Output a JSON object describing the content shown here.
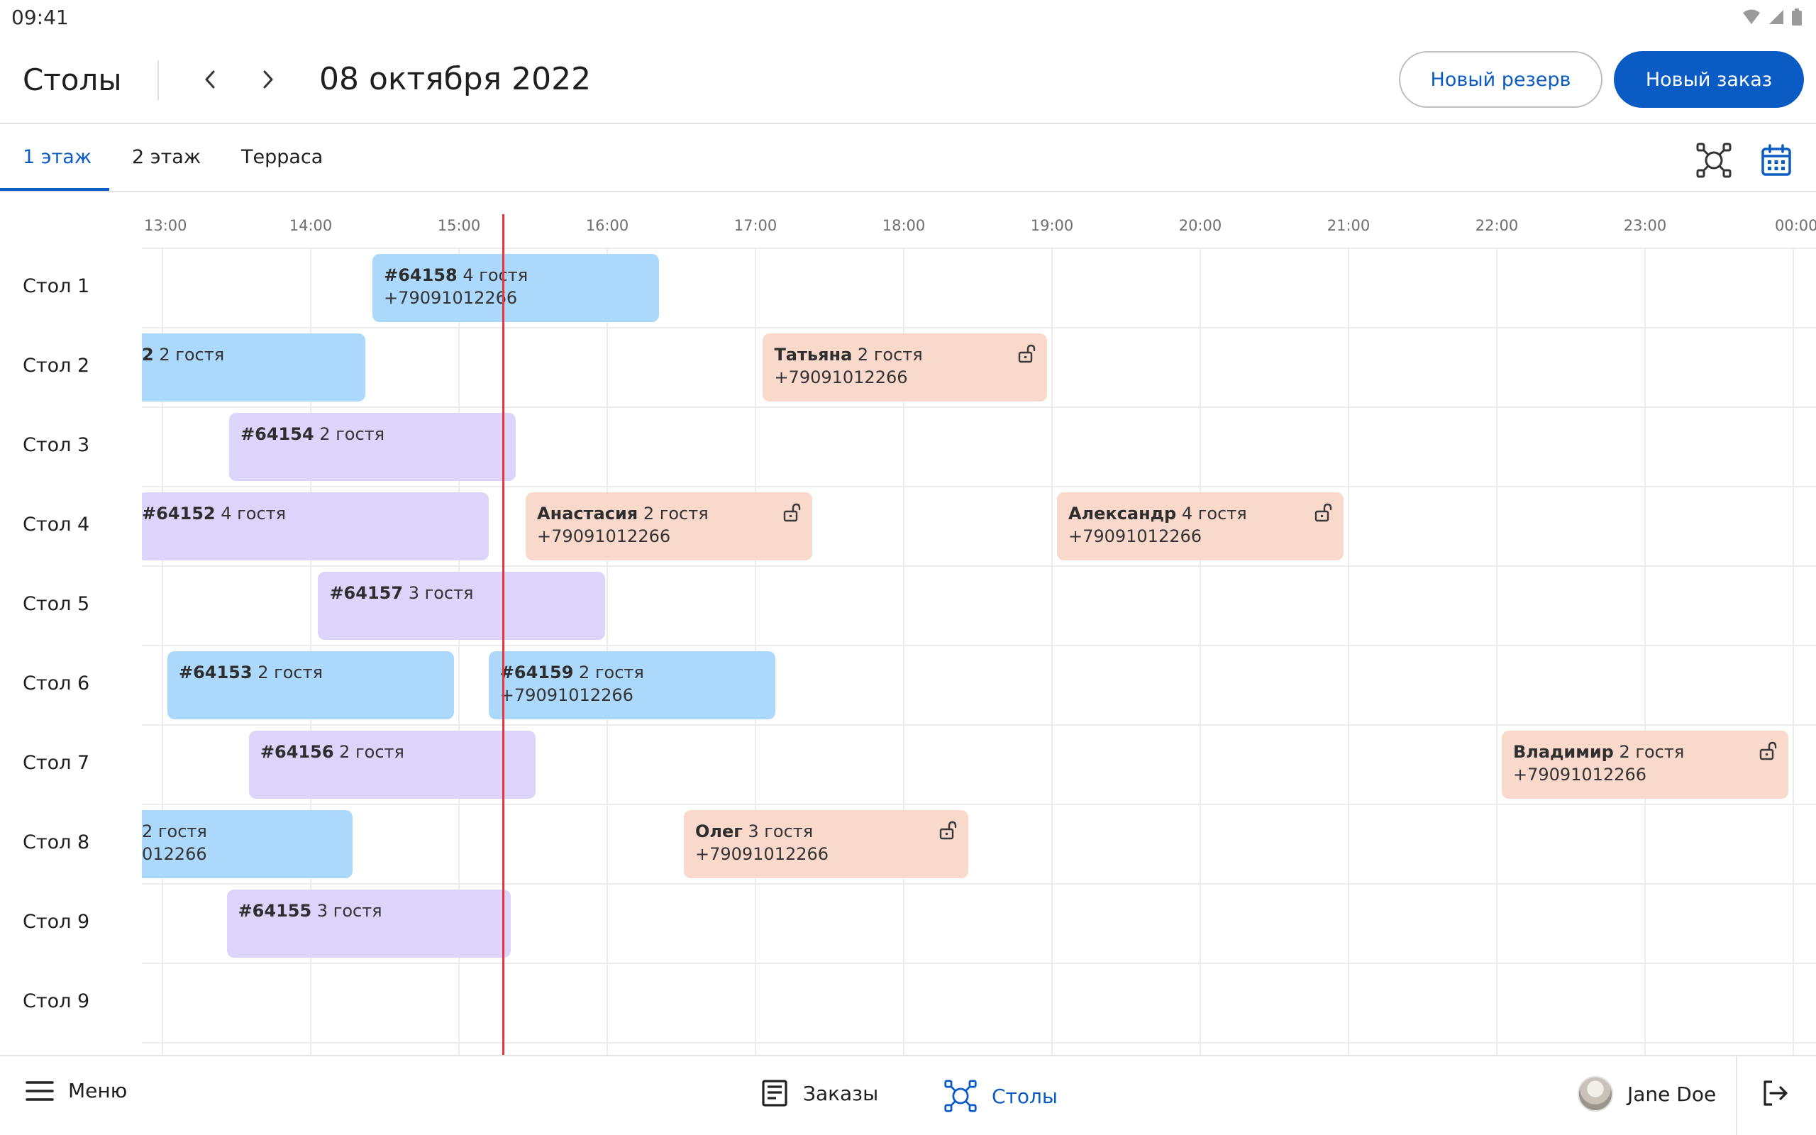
{
  "status_bar": {
    "time": "09:41"
  },
  "header": {
    "title": "Столы",
    "date": "08 октября 2022",
    "new_reserve_label": "Новый резерв",
    "new_order_label": "Новый заказ"
  },
  "tabs": [
    {
      "label": "1 этаж",
      "active": true
    },
    {
      "label": "2 этаж",
      "active": false
    },
    {
      "label": "Терраса",
      "active": false
    }
  ],
  "timeline": {
    "hours": [
      "13:00",
      "14:00",
      "15:00",
      "16:00",
      "17:00",
      "18:00",
      "19:00",
      "20:00",
      "21:00",
      "22:00",
      "23:00",
      "00:00"
    ],
    "current_time": "15:18",
    "rows": [
      "Стол 1",
      "Стол 2",
      "Стол 3",
      "Стол 4",
      "Стол 5",
      "Стол 6",
      "Стол 7",
      "Стол 8",
      "Стол 9",
      "Стол 9"
    ],
    "bookings": [
      {
        "row": 0,
        "start": "14:25",
        "end": "16:21",
        "color": "blue",
        "title": "#64158",
        "guests": "4 гостя",
        "phone": "+79091012266",
        "locked": false
      },
      {
        "row": 1,
        "start": "12:37",
        "end": "14:22",
        "color": "blue",
        "title": "2",
        "guests": "2 гостя",
        "phone": "",
        "locked": false
      },
      {
        "row": 1,
        "start": "17:03",
        "end": "18:58",
        "color": "peach",
        "title": "Татьяна",
        "guests": "2 гостя",
        "phone": "+79091012266",
        "locked": true
      },
      {
        "row": 2,
        "start": "13:27",
        "end": "15:23",
        "color": "purple",
        "title": "#64154",
        "guests": "2 гостя",
        "phone": "",
        "locked": false
      },
      {
        "row": 3,
        "start": "12:50",
        "end": "15:12",
        "color": "purple",
        "title": "#64152",
        "guests": "4 гостя",
        "phone": "",
        "locked": false
      },
      {
        "row": 3,
        "start": "15:27",
        "end": "17:23",
        "color": "peach",
        "title": "Анастасия",
        "guests": "2 гостя",
        "phone": "+79091012266",
        "locked": true
      },
      {
        "row": 3,
        "start": "19:02",
        "end": "20:58",
        "color": "peach",
        "title": "Александр",
        "guests": "4 гостя",
        "phone": "+79091012266",
        "locked": true
      },
      {
        "row": 4,
        "start": "14:03",
        "end": "15:59",
        "color": "purple",
        "title": "#64157",
        "guests": "3 гостя",
        "phone": "",
        "locked": false
      },
      {
        "row": 5,
        "start": "13:02",
        "end": "14:58",
        "color": "blue",
        "title": "#64153",
        "guests": "2 гостя",
        "phone": "",
        "locked": false
      },
      {
        "row": 5,
        "start": "15:12",
        "end": "17:08",
        "color": "blue",
        "title": "#64159",
        "guests": "2 гостя",
        "phone": "+79091012266",
        "locked": false
      },
      {
        "row": 6,
        "start": "13:35",
        "end": "15:31",
        "color": "purple",
        "title": "#64156",
        "guests": "2 гостя",
        "phone": "",
        "locked": false
      },
      {
        "row": 6,
        "start": "22:02",
        "end": "23:58",
        "color": "peach",
        "title": "Владимир",
        "guests": "2 гостя",
        "phone": "+79091012266",
        "locked": true
      },
      {
        "row": 7,
        "start": "12:37",
        "end": "14:17",
        "color": "blue",
        "title": "",
        "guests": "2 гостя",
        "phone": "012266",
        "locked": false
      },
      {
        "row": 7,
        "start": "16:31",
        "end": "18:26",
        "color": "peach",
        "title": "Олег",
        "guests": "3 гостя",
        "phone": "+79091012266",
        "locked": true
      },
      {
        "row": 8,
        "start": "13:26",
        "end": "15:21",
        "color": "purple",
        "title": "#64155",
        "guests": "3 гостя",
        "phone": "",
        "locked": false
      }
    ]
  },
  "bottom_nav": {
    "menu_label": "Меню",
    "orders_label": "Заказы",
    "tables_label": "Столы",
    "user_name": "Jane Doe"
  },
  "colors": {
    "accent": "#0a5bc4",
    "now_line": "#e8353a",
    "blue": "#acd8fb",
    "purple": "#dcd4fb",
    "peach": "#f8d9cb"
  },
  "icons": [
    "chevron-left-icon",
    "chevron-right-icon",
    "tables-layout-icon",
    "calendar-icon",
    "lock-open-icon",
    "menu-icon",
    "orders-icon",
    "logout-icon",
    "wifi-icon",
    "signal-icon",
    "battery-icon"
  ]
}
